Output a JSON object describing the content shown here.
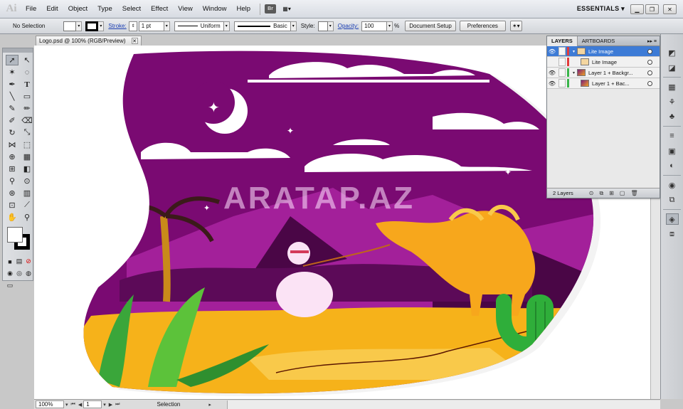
{
  "app": {
    "logo": "Ai"
  },
  "menubar": {
    "items": [
      "File",
      "Edit",
      "Object",
      "Type",
      "Select",
      "Effect",
      "View",
      "Window",
      "Help"
    ],
    "bridge_badge": "Br",
    "workspace": "ESSENTIALS",
    "window_controls": [
      "minimize",
      "restore",
      "close"
    ]
  },
  "controlbar": {
    "selection_label": "No Selection",
    "stroke_label": "Stroke:",
    "stroke_weight": "1 pt",
    "profile_label": "Uniform",
    "brush_label": "Basic",
    "style_label": "Style:",
    "opacity_label": "Opacity:",
    "opacity_value": "100",
    "opacity_unit": "%",
    "document_setup": "Document Setup",
    "preferences": "Preferences"
  },
  "document": {
    "tab_title": "Logo.psd @ 100% (RGB/Preview)",
    "watermark": "ARATAP.AZ"
  },
  "layers_panel": {
    "tabs": [
      "LAYERS",
      "ARTBOARDS"
    ],
    "rows": [
      {
        "name": "Lite Image",
        "level": 0,
        "selected": true,
        "color": "#e23b3b"
      },
      {
        "name": "Lite Image",
        "level": 1,
        "selected": false,
        "color": "#e23b3b"
      },
      {
        "name": "Layer 1 + Backgr...",
        "level": 0,
        "selected": false,
        "color": "#39b54a"
      },
      {
        "name": "Layer 1 + Bac...",
        "level": 1,
        "selected": false,
        "color": "#39b54a"
      }
    ],
    "footer_count": "2 Layers"
  },
  "statusbar": {
    "zoom": "100%",
    "artboard": "1",
    "mode": "Selection"
  },
  "colors": {
    "sky": "#7a0a72",
    "sand": "#f6b21a",
    "cactus": "#3bb13b",
    "selection": "#3d7bd6"
  },
  "icons": [
    "selection-tool-icon",
    "direct-selection-icon",
    "pen-icon",
    "type-icon",
    "eye-icon",
    "layer-menu-icon"
  ]
}
